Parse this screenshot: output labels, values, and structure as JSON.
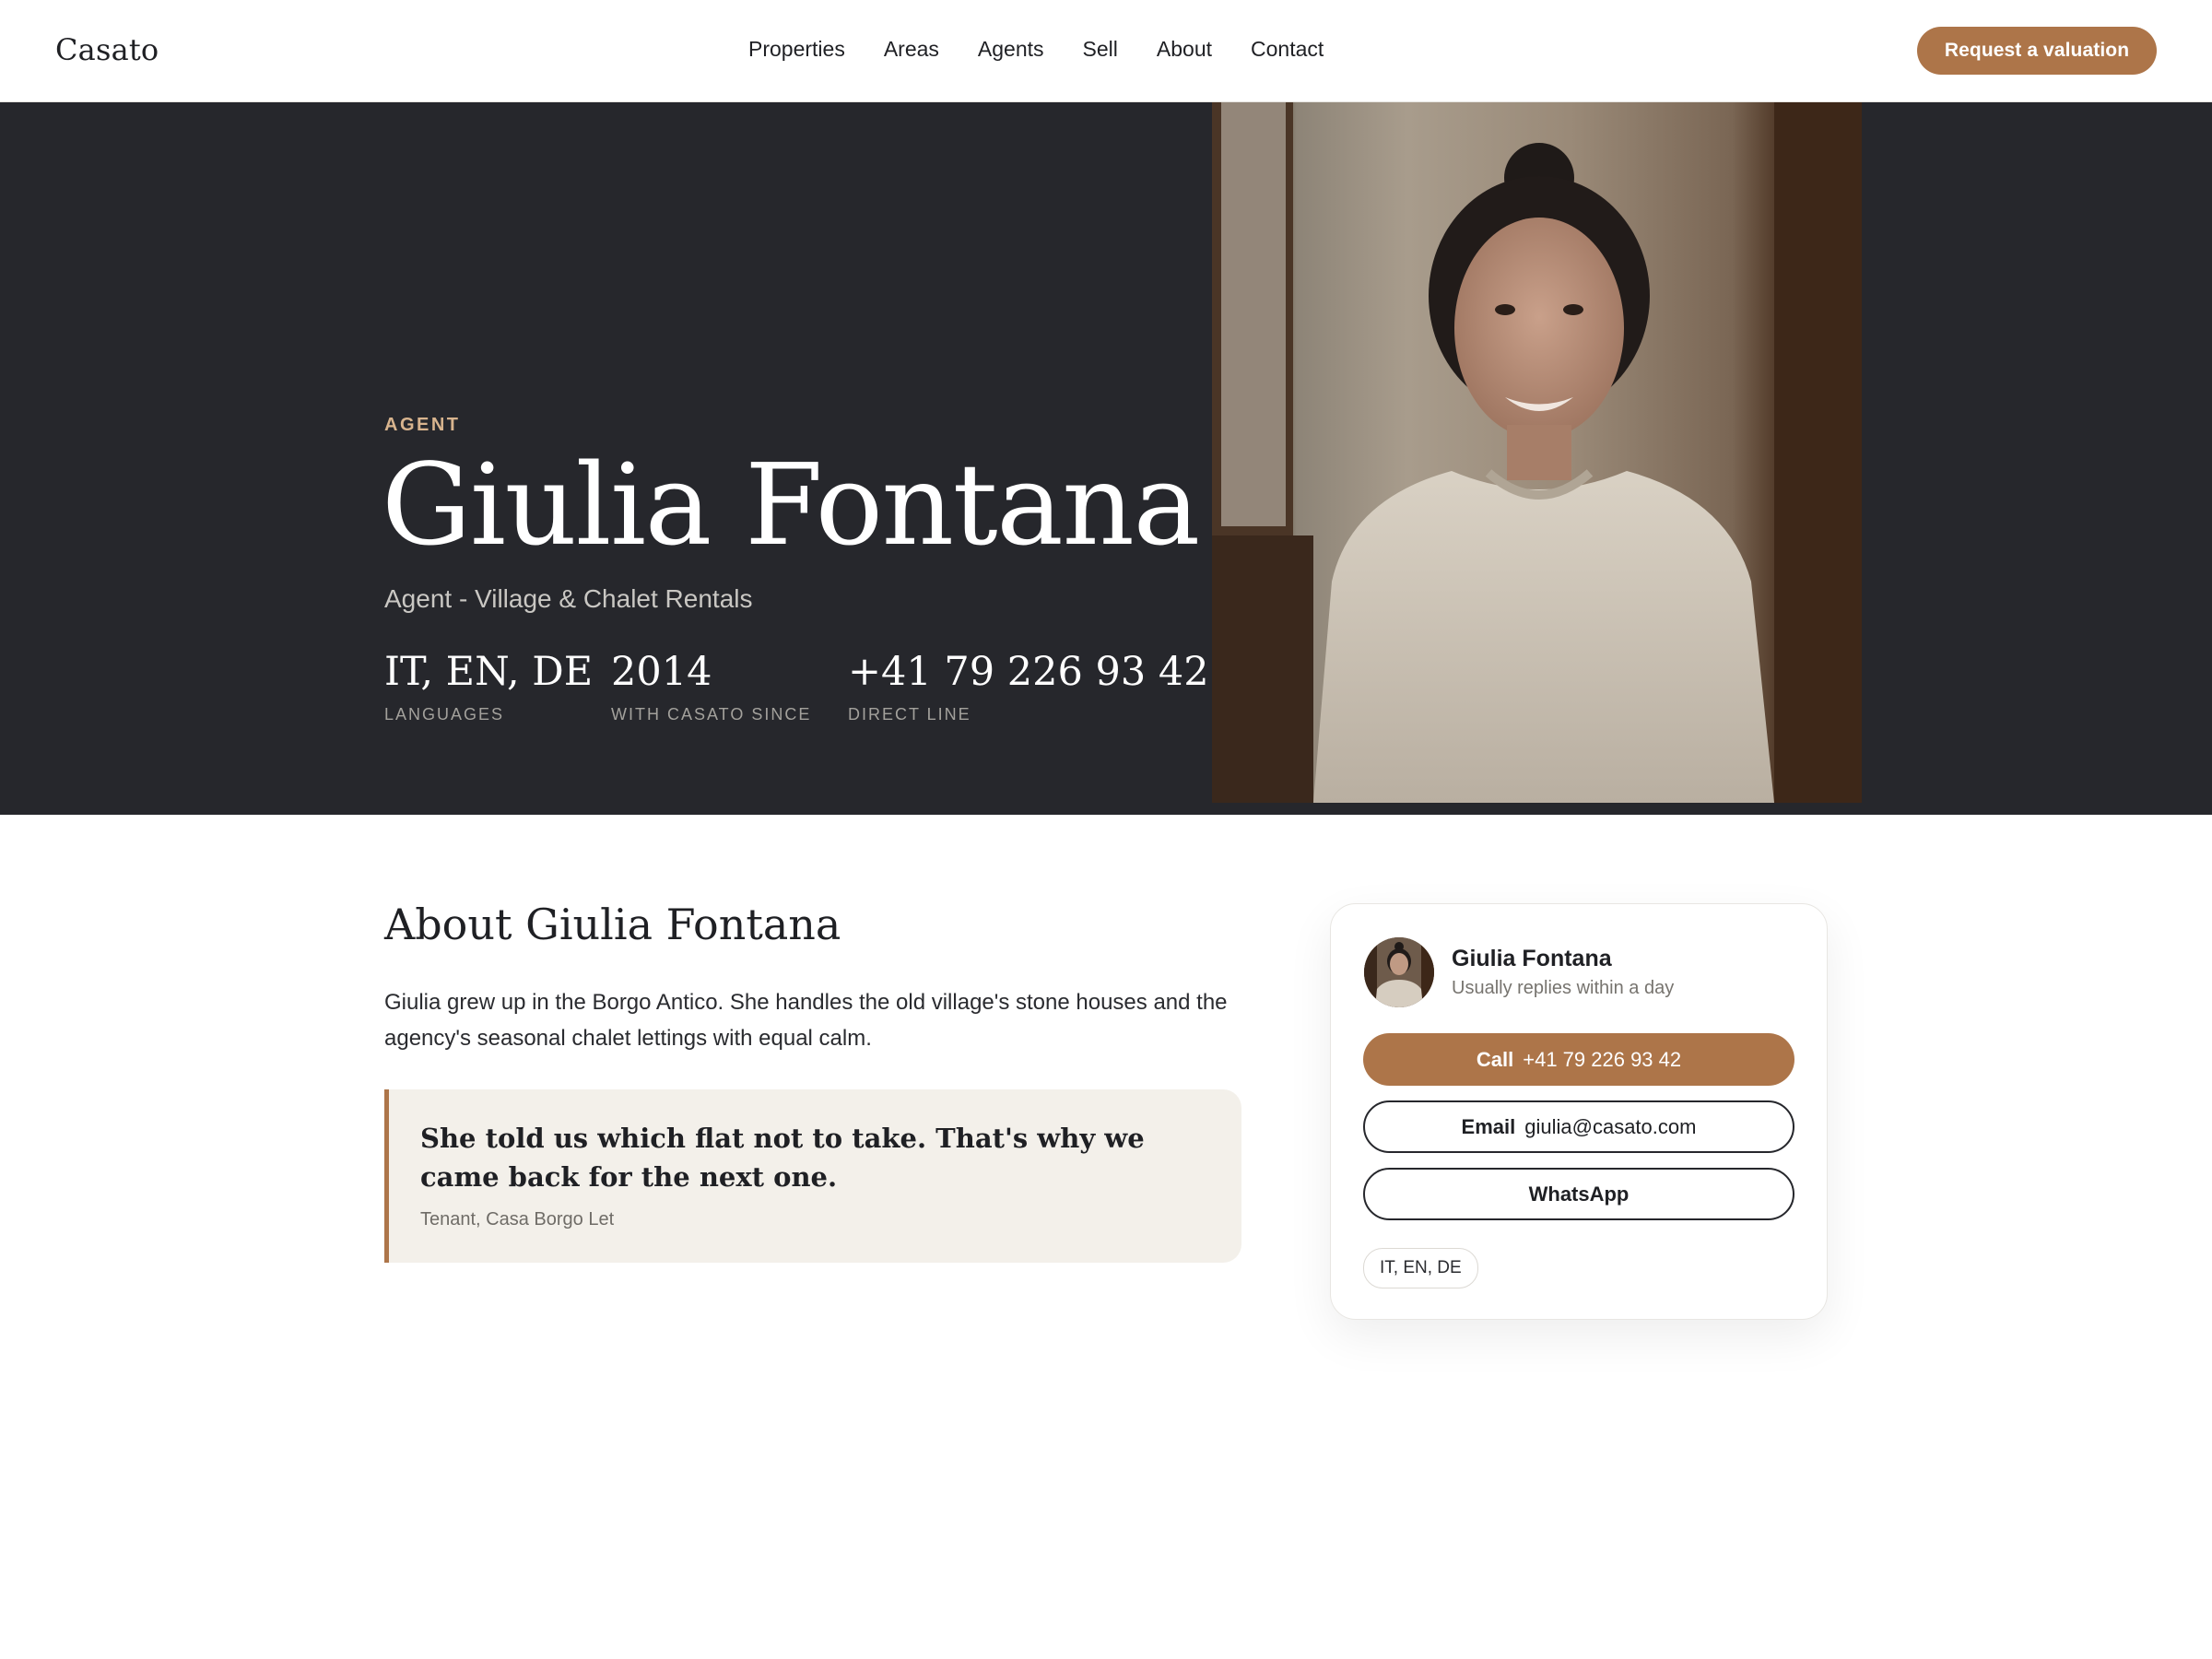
{
  "brand": {
    "name": "Casato",
    "accent": "#ad7549",
    "dark": "#26272c"
  },
  "nav": {
    "links": [
      "Properties",
      "Areas",
      "Agents",
      "Sell",
      "About",
      "Contact"
    ],
    "cta_label": "Request a valuation"
  },
  "hero": {
    "eyebrow": "AGENT",
    "name": "Giulia Fontana",
    "role": "Agent - Village & Chalet Rentals",
    "stats": [
      {
        "value": "IT, EN, DE",
        "label": "LANGUAGES"
      },
      {
        "value": "2014",
        "label": "WITH CASATO SINCE"
      },
      {
        "value": "+41 79 226 93 42",
        "label": "DIRECT LINE"
      }
    ],
    "photo_subject": "agent-portrait"
  },
  "about": {
    "title": "About Giulia Fontana",
    "body": "Giulia grew up in the Borgo Antico. She handles the old village's stone houses and the agency's seasonal chalet lettings with equal calm.",
    "quote": "She told us which flat not to take. That's why we came back for the next one.",
    "quote_source": "Tenant, Casa Borgo Let"
  },
  "contact_card": {
    "name": "Giulia Fontana",
    "subtitle": "Usually replies within a day",
    "call_key": "Call",
    "call_value": "+41 79 226 93 42",
    "email_key": "Email",
    "email_value": "giulia@casato.com",
    "whatsapp_label": "WhatsApp",
    "languages_chip": "IT, EN, DE"
  }
}
